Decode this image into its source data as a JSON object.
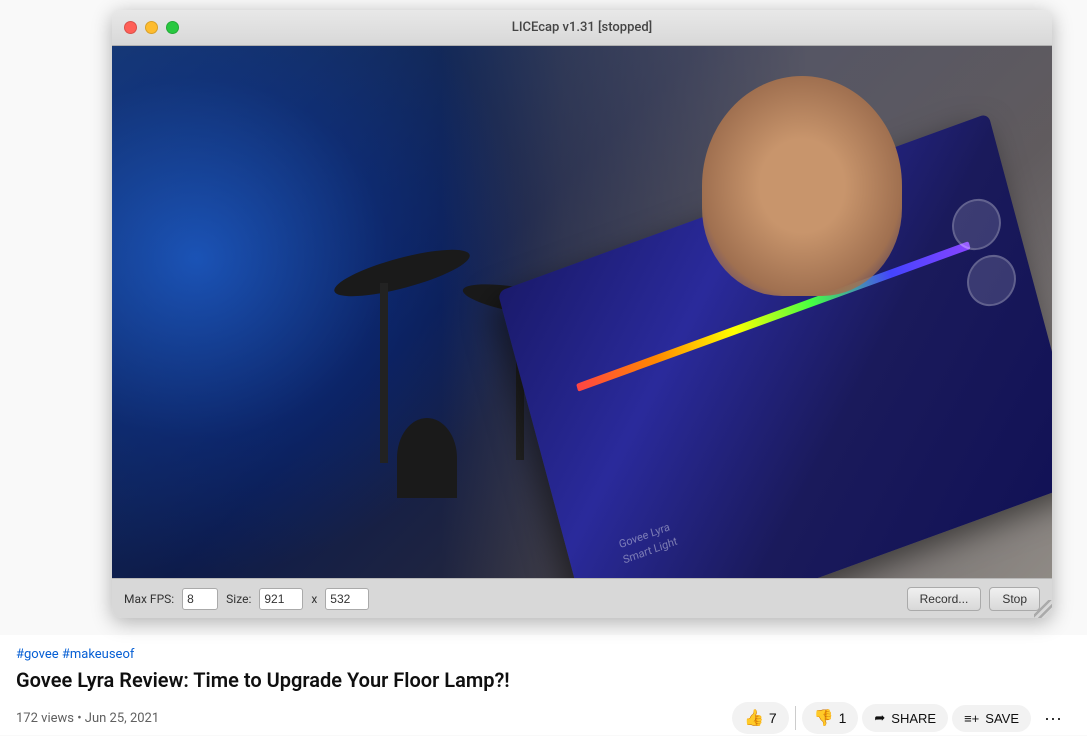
{
  "titlebar": {
    "title": "LICEcap v1.31 [stopped]",
    "close_label": "close",
    "minimize_label": "minimize",
    "maximize_label": "maximize"
  },
  "controls": {
    "max_fps_label": "Max FPS:",
    "fps_value": "8",
    "size_label": "Size:",
    "width_value": "921",
    "x_separator": "x",
    "height_value": "532",
    "record_button": "Record...",
    "stop_button": "Stop"
  },
  "video": {
    "tags": "#govee #makeuseof",
    "title": "Govee Lyra Review: Time to Upgrade Your Floor Lamp?!",
    "views": "172 views",
    "date": "Jun 25, 2021",
    "stats": "172 views • Jun 25, 2021",
    "like_count": "7",
    "dislike_count": "1",
    "share_label": "SHARE",
    "save_label": "SAVE"
  },
  "icons": {
    "like": "👍",
    "dislike": "👎",
    "share": "➦",
    "save": "☰+",
    "more": "•••"
  }
}
